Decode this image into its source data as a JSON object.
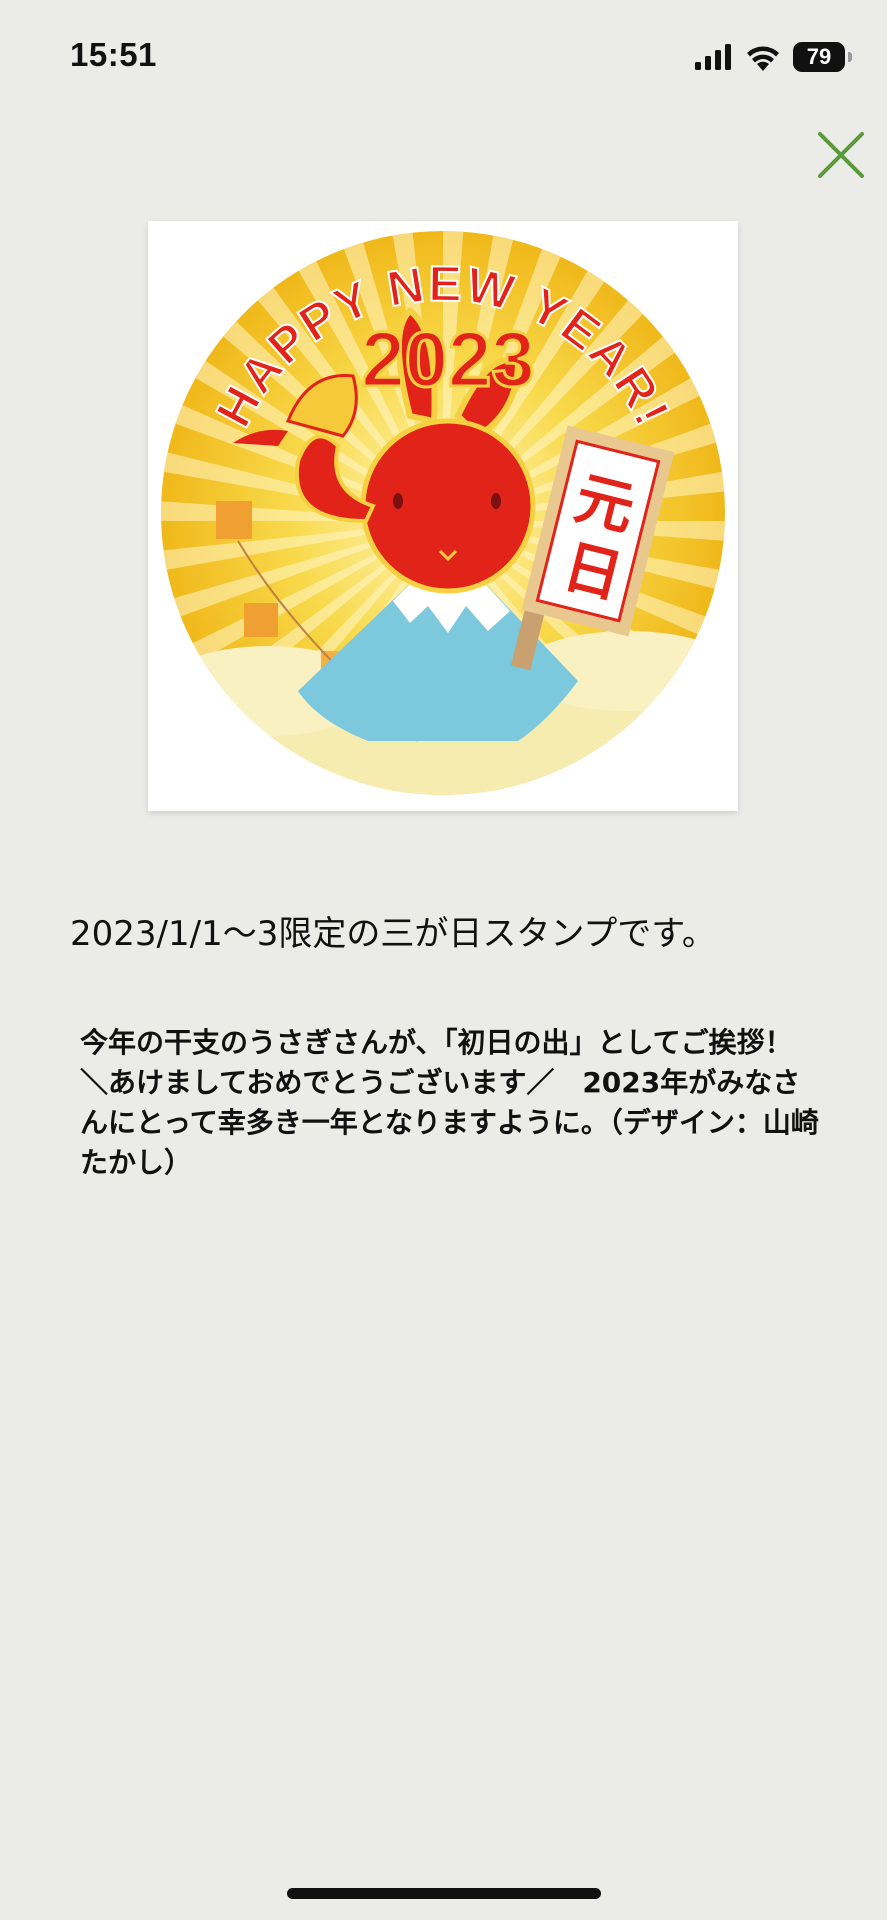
{
  "status_bar": {
    "time": "15:51",
    "battery_level": "79",
    "icons": [
      "signal-icon",
      "wifi-icon",
      "battery-icon"
    ]
  },
  "close_button": {
    "icon": "close-icon",
    "color": "#5a9a3a"
  },
  "stamp": {
    "banner": "HAPPY NEW YEAR!",
    "year": "2023",
    "sign": "元日",
    "colors": {
      "sun": "#f3c51a",
      "rabbit": "#e2231a",
      "mountain": "#7cc8dc",
      "cloud": "#f7ecb0"
    }
  },
  "headline": "2023/1/1〜3限定の三が日スタンプです。",
  "description": "今年の干支のうさぎさんが、「初日の出」としてご挨拶！　＼あけましておめでとうございます／　2023年がみなさんにとって幸多き一年となりますように。（デザイン：山崎たかし）"
}
